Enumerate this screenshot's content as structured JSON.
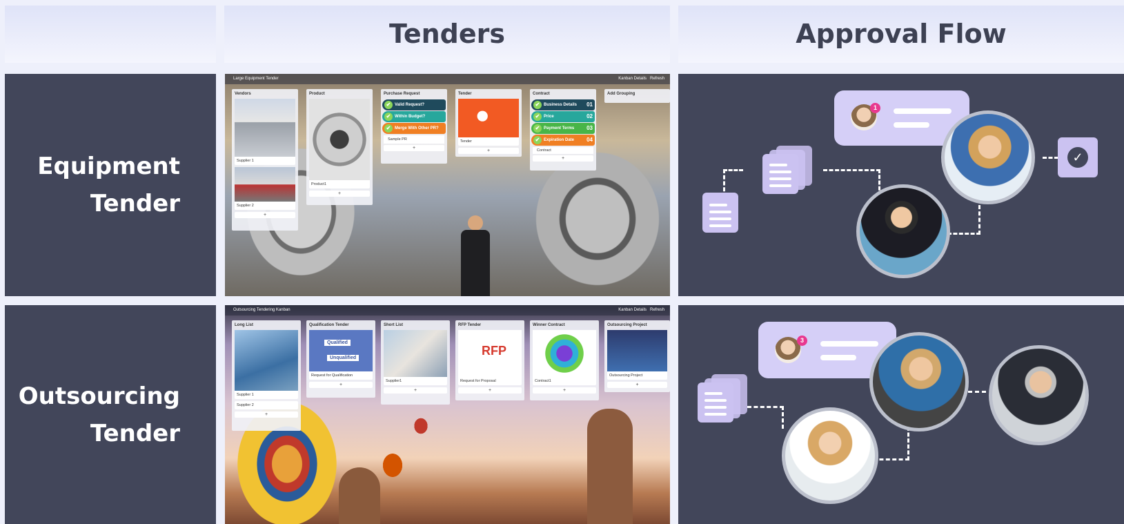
{
  "headers": {
    "tenders": "Tenders",
    "approval_flow": "Approval Flow"
  },
  "rows": [
    {
      "label": "Equipment\nTender",
      "kanban": {
        "title": "Large Equipment Tender",
        "actions": [
          "Kanban Details",
          "Refresh"
        ],
        "columns": [
          {
            "title": "Vendors",
            "cards": [
              "Supplier 1",
              "Supplier 2"
            ]
          },
          {
            "title": "Product",
            "cards": [
              "Product1"
            ]
          },
          {
            "title": "Purchase Request",
            "cards": [
              "Sample PR"
            ],
            "checks": [
              "Valid Request?",
              "Within Budget?",
              "Merge With Other PR?"
            ]
          },
          {
            "title": "Tender",
            "cards": [
              "Tender"
            ]
          },
          {
            "title": "Contract",
            "cards": [
              "Contract"
            ],
            "checks": [
              "Business Details",
              "Price",
              "Payment Terms",
              "Expiration Date"
            ],
            "numbers": [
              "01",
              "02",
              "03",
              "04"
            ]
          },
          {
            "title": "Add Grouping",
            "cards": []
          }
        ]
      },
      "flow": {
        "badge": "1"
      }
    },
    {
      "label": "Outsourcing\nTender",
      "kanban": {
        "title": "Outsourcing Tendering Kanban",
        "actions": [
          "Kanban Details",
          "Refresh"
        ],
        "columns": [
          {
            "title": "Long List",
            "cards": [
              "Supplier 1",
              "Supplier 2"
            ]
          },
          {
            "title": "Qualification Tender",
            "cards": [
              "Request for Qualification"
            ],
            "image_text": [
              "Qualified",
              "Unqualified"
            ]
          },
          {
            "title": "Short List",
            "cards": [
              "Supplier1"
            ]
          },
          {
            "title": "RFP Tender",
            "cards": [
              "Request for Proposal"
            ],
            "image_text": [
              "RFP"
            ]
          },
          {
            "title": "Winner Contract",
            "cards": [
              "Contract1"
            ]
          },
          {
            "title": "Outsourcing Project",
            "cards": [
              "Outsourcing Project"
            ]
          }
        ]
      },
      "flow": {
        "badge": "3"
      }
    }
  ],
  "colors": {
    "panel": "#42465a",
    "bubble": "#d5cff7",
    "badge": "#e8388f"
  }
}
